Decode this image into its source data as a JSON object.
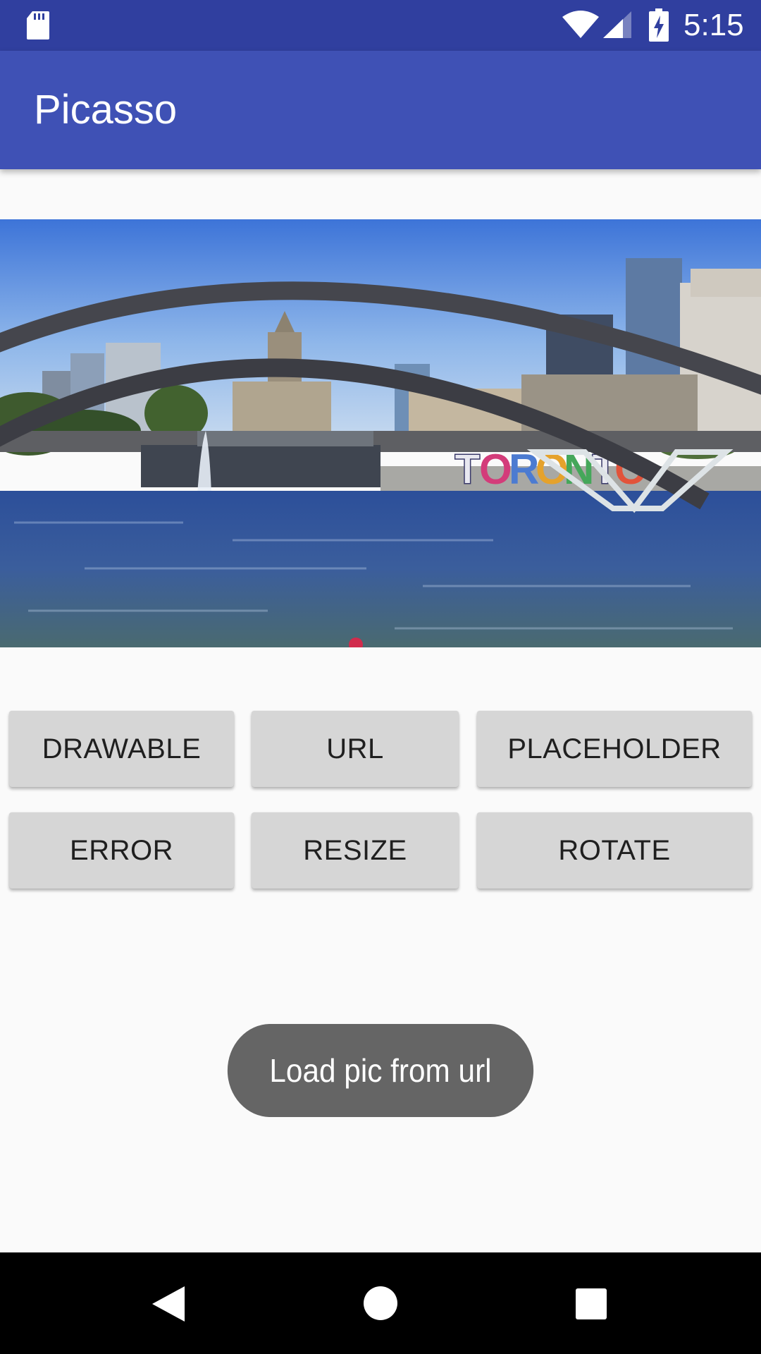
{
  "status_bar": {
    "time": "5:15",
    "icons": [
      "sd-card-icon",
      "wifi-icon",
      "cell-signal-icon",
      "battery-charging-icon"
    ]
  },
  "app_bar": {
    "title": "Picasso"
  },
  "image": {
    "subject": "Toronto city hall square with arches, fountain and TORONTO sign"
  },
  "buttons": {
    "drawable": "DRAWABLE",
    "url": "URL",
    "placeholder": "PLACEHOLDER",
    "error": "ERROR",
    "resize": "RESIZE",
    "rotate": "ROTATE"
  },
  "toast": {
    "message": "Load pic from url"
  },
  "nav_bar": {
    "icons": [
      "back-icon",
      "home-icon",
      "recents-icon"
    ]
  },
  "colors": {
    "status_bar": "#303f9f",
    "app_bar": "#3f51b5",
    "button": "#d6d6d6",
    "toast": "#656565",
    "background": "#fafafa"
  }
}
